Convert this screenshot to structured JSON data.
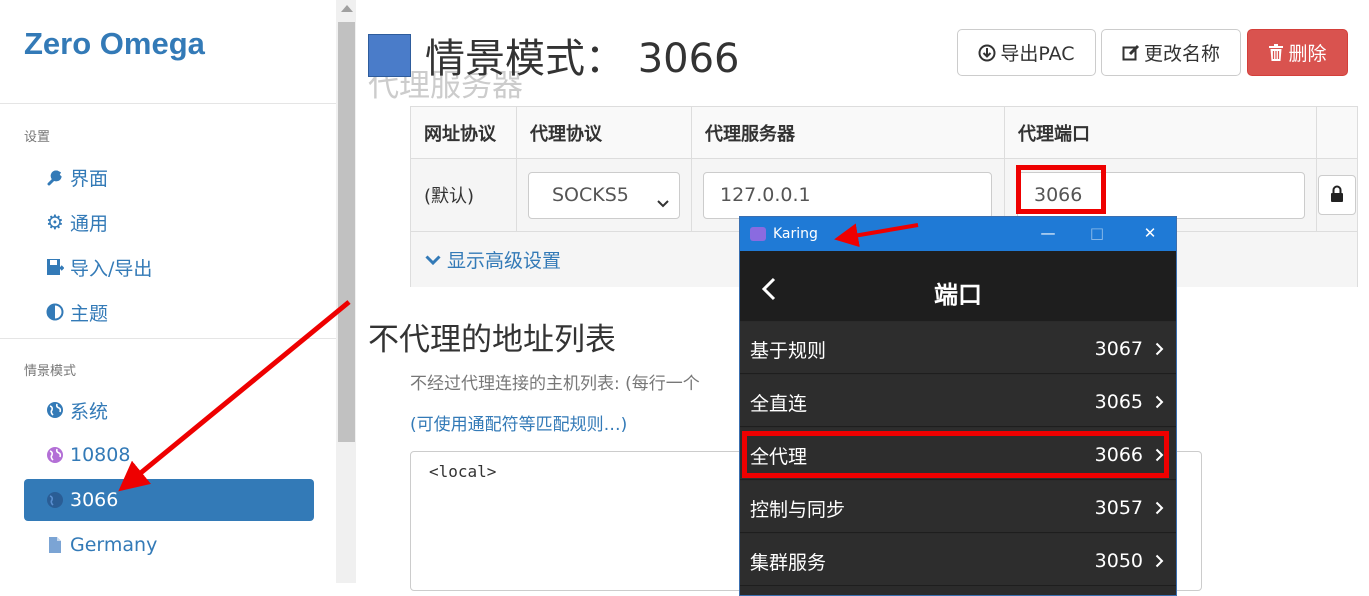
{
  "sidebar": {
    "brand": "Zero Omega",
    "section_settings": "设置",
    "settings_items": [
      {
        "label": "界面",
        "icon": "wrench-icon"
      },
      {
        "label": "通用",
        "icon": "gear-icon"
      },
      {
        "label": "导入/导出",
        "icon": "floppy-icon"
      },
      {
        "label": "主题",
        "icon": "contrast-icon"
      }
    ],
    "section_profiles": "情景模式",
    "profile_items": [
      {
        "label": "系统",
        "icon": "globe-icon"
      },
      {
        "label": "10808",
        "icon": "globe-icon",
        "color": "#b36fd6"
      },
      {
        "label": "3066",
        "icon": "globe-icon",
        "active": true
      },
      {
        "label": "Germany",
        "icon": "file-icon"
      }
    ]
  },
  "header": {
    "title": "情景模式： 3066",
    "faded_heading": "代理服务器",
    "export_pac_label": "导出PAC",
    "rename_label": "更改名称",
    "delete_label": "删除"
  },
  "proxy_table": {
    "columns": [
      "网址协议",
      "代理协议",
      "代理服务器",
      "代理端口"
    ],
    "row": {
      "scheme": "(默认)",
      "protocol": "SOCKS5",
      "server": "127.0.0.1",
      "port": "3066"
    },
    "advanced_label": "显示高级设置"
  },
  "bypass": {
    "heading": "不代理的地址列表",
    "help": "不经过代理连接的主机列表: (每行一个",
    "link": "(可使用通配符等匹配规则…)",
    "value": "<local>"
  },
  "karing": {
    "app_name": "Karing",
    "page_title": "端口",
    "rows": [
      {
        "label": "基于规则",
        "value": "3067"
      },
      {
        "label": "全直连",
        "value": "3065"
      },
      {
        "label": "全代理",
        "value": "3066"
      },
      {
        "label": "控制与同步",
        "value": "3057"
      },
      {
        "label": "集群服务",
        "value": "3050"
      }
    ]
  },
  "colors": {
    "accent": "#337ab7",
    "danger": "#d9534f",
    "annotation": "#ee0000",
    "karing_titlebar": "#1f7ad6"
  }
}
